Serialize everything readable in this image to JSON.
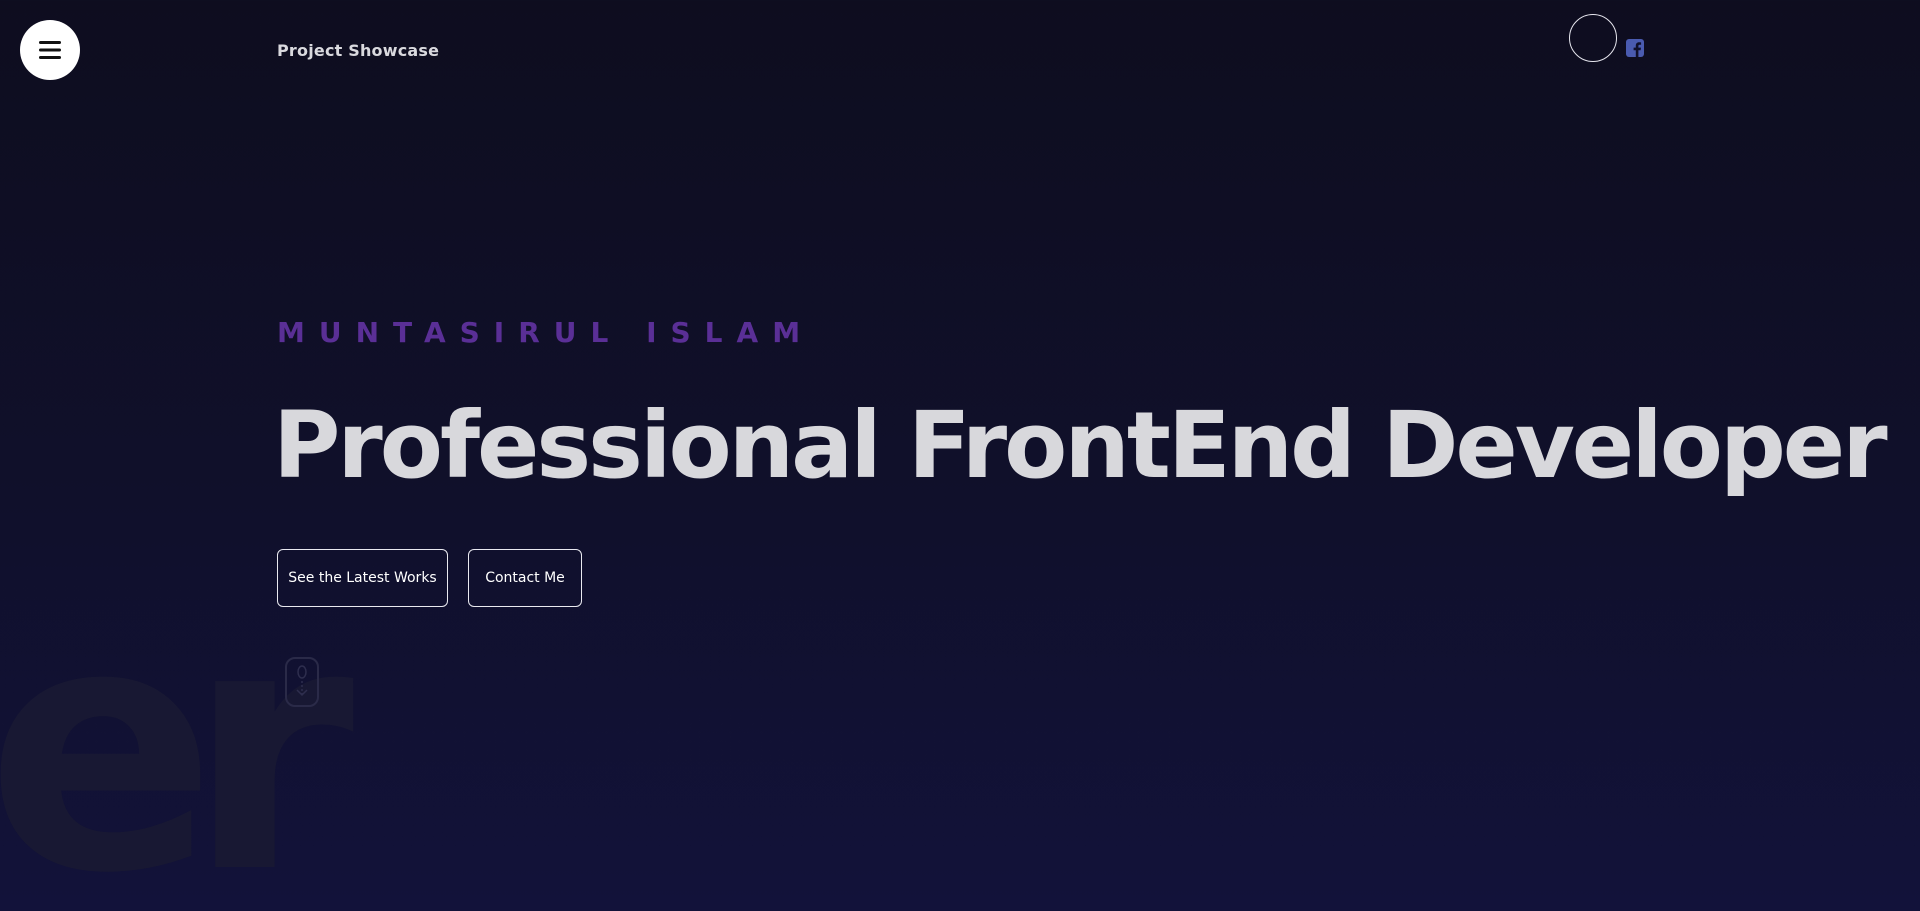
{
  "header": {
    "site_title": "Project Showcase",
    "menu_icon": "hamburger-menu-icon",
    "social_icon": "facebook-icon",
    "social_color": "#4a5bb0"
  },
  "hero": {
    "name": "MUNTASIRUL ISLAM",
    "headline": "Professional FrontEnd Developer",
    "buttons": {
      "latest_works": "See the Latest Works",
      "contact": "Contact Me"
    },
    "background_word": "er",
    "scroll_icon": "mouse-scroll-down-icon"
  },
  "colors": {
    "background": "#0e0d1f",
    "accent": "#5a2f96",
    "headline": "#d8d8dc"
  }
}
